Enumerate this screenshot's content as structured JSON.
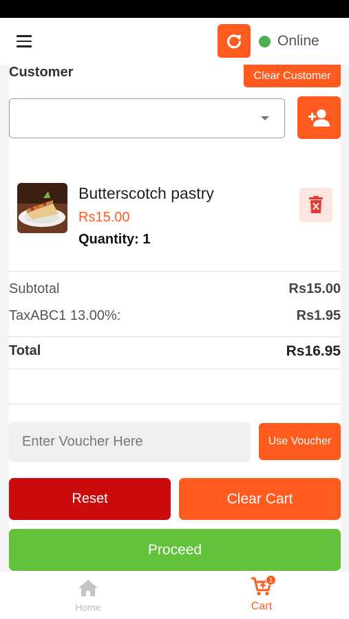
{
  "status": {
    "connection_label": "Online",
    "connection_color": "#4caf50"
  },
  "customer": {
    "title": "Customer",
    "clear_label": "Clear Customer",
    "selected_value": ""
  },
  "cart": {
    "items": [
      {
        "name": "Butterscotch pastry",
        "price": "Rs15.00",
        "quantity_text": "Quantity: 1",
        "image_icon": "pastry-photo"
      }
    ]
  },
  "summary": {
    "subtotal_label": "Subtotal",
    "subtotal_value": "Rs15.00",
    "tax_label": "TaxABC1 13.00%:",
    "tax_value": "Rs1.95",
    "total_label": "Total",
    "total_value": "Rs16.95"
  },
  "voucher": {
    "placeholder": "Enter Voucher Here",
    "value": "",
    "button_label": "Use Voucher"
  },
  "actions": {
    "reset_label": "Reset",
    "clear_cart_label": "Clear Cart",
    "proceed_label": "Proceed"
  },
  "nav": {
    "home_label": "Home",
    "cart_label": "Cart",
    "cart_badge": "1"
  },
  "colors": {
    "accent": "#ff5b1f",
    "danger": "#cc0c0c",
    "success": "#62c23c"
  }
}
